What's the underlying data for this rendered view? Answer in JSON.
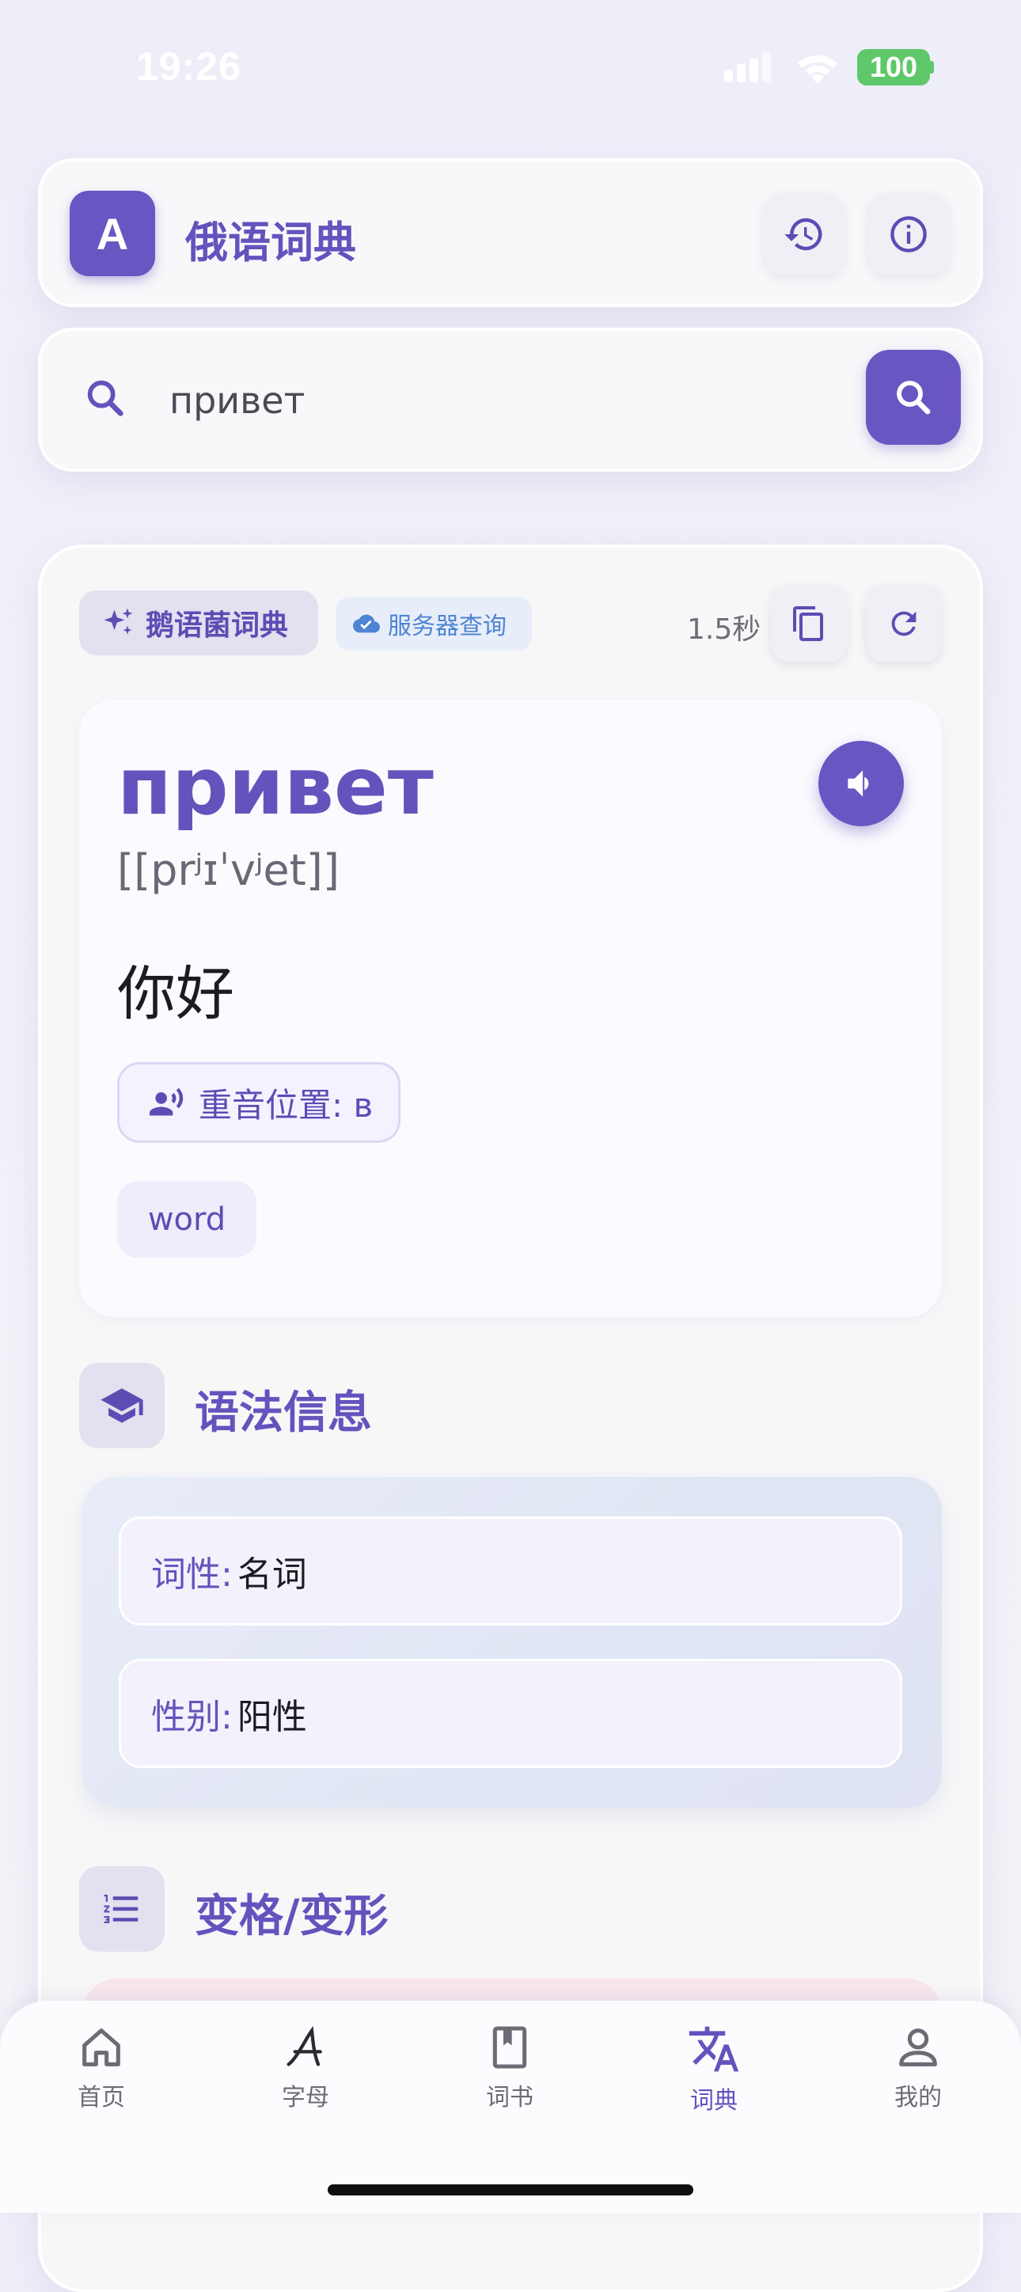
{
  "status_bar": {
    "time": "19:26",
    "battery": "100"
  },
  "header": {
    "app_icon_letter": "A",
    "title": "俄语词典",
    "history_icon": "history-icon",
    "info_icon": "info-icon"
  },
  "search": {
    "value": "привет",
    "placeholder": ""
  },
  "result": {
    "source_chip": "鹅语菌词典",
    "server_chip": "服务器查询",
    "elapsed": "1.5秒",
    "word": "привет",
    "ipa": "[[prʲɪˈvʲet]]",
    "translation": "你好",
    "stress": "重音位置: в",
    "tag": "word"
  },
  "grammar": {
    "title": "语法信息",
    "rows": [
      {
        "key": "词性:",
        "value": "名词"
      },
      {
        "key": "性别:",
        "value": "阳性"
      }
    ]
  },
  "declension": {
    "title": "变格/变形"
  },
  "tabs": [
    {
      "label": "首页",
      "icon": "home-icon",
      "active": false
    },
    {
      "label": "字母",
      "icon": "letter-a-icon",
      "active": false
    },
    {
      "label": "词书",
      "icon": "book-icon",
      "active": false
    },
    {
      "label": "词典",
      "icon": "translate-icon",
      "active": true
    },
    {
      "label": "我的",
      "icon": "person-icon",
      "active": false
    }
  ],
  "colors": {
    "accent": "#6a56c2",
    "accent_text": "#6552bd",
    "server_blue": "#4d84d4",
    "battery_green": "#5fc86a"
  }
}
